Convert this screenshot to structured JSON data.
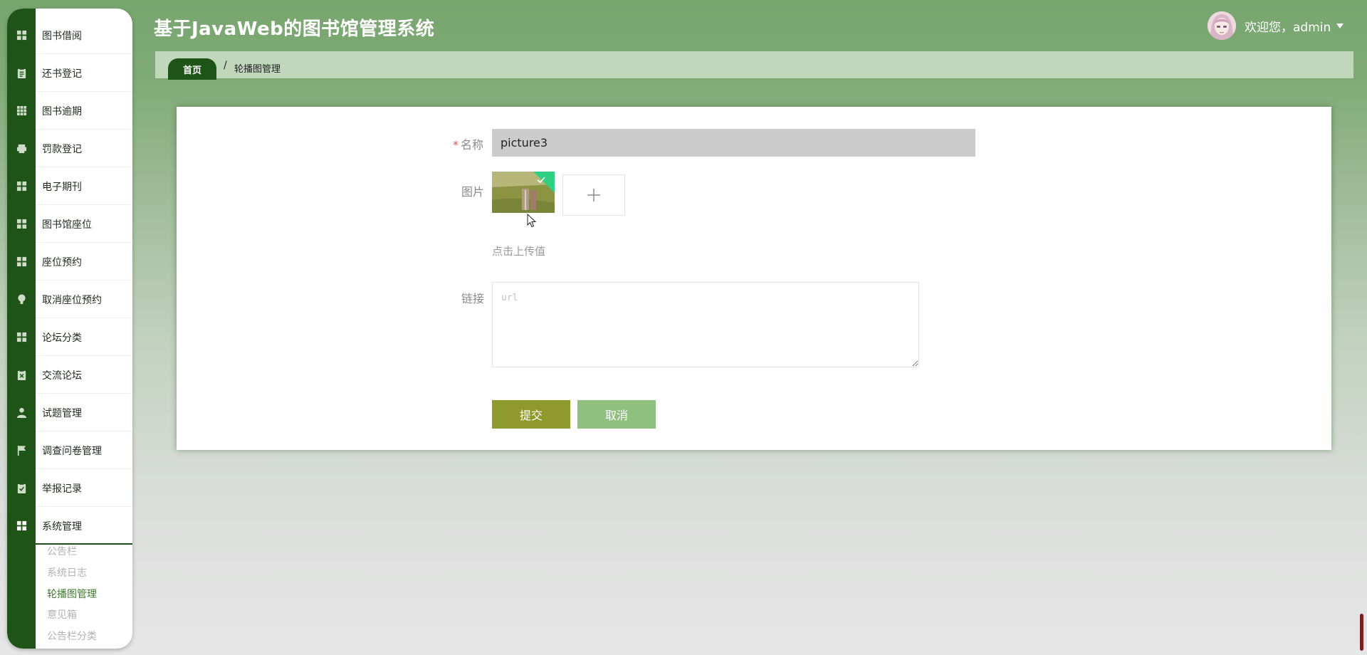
{
  "header": {
    "title": "基于JavaWeb的图书馆管理系统",
    "welcome": "欢迎您，admin"
  },
  "sidebar": {
    "items": [
      {
        "label": "图书借阅",
        "icon": "grid-icon"
      },
      {
        "label": "还书登记",
        "icon": "clipboard-icon"
      },
      {
        "label": "图书逾期",
        "icon": "apps-icon"
      },
      {
        "label": "罚款登记",
        "icon": "printer-icon"
      },
      {
        "label": "电子期刊",
        "icon": "grid-icon"
      },
      {
        "label": "图书馆座位",
        "icon": "grid-icon"
      },
      {
        "label": "座位预约",
        "icon": "grid-icon"
      },
      {
        "label": "取消座位预约",
        "icon": "bulb-icon"
      },
      {
        "label": "论坛分类",
        "icon": "grid-icon"
      },
      {
        "label": "交流论坛",
        "icon": "clipboard-x-icon"
      },
      {
        "label": "试题管理",
        "icon": "user-icon"
      },
      {
        "label": "调查问卷管理",
        "icon": "flag-icon"
      },
      {
        "label": "举报记录",
        "icon": "clipboard-check-icon"
      },
      {
        "label": "系统管理",
        "icon": "grid-icon"
      }
    ],
    "subitems": [
      {
        "label": "公告栏"
      },
      {
        "label": "系统日志"
      },
      {
        "label": "轮播图管理"
      },
      {
        "label": "意见箱"
      },
      {
        "label": "公告栏分类"
      }
    ]
  },
  "breadcrumb": {
    "home": "首页",
    "separator": "/",
    "current": "轮播图管理"
  },
  "form": {
    "required_mark": "*",
    "name_label": "名称",
    "name_value": "picture3",
    "image_label": "图片",
    "upload_hint": "点击上传值",
    "link_label": "链接",
    "link_placeholder": "url",
    "submit_label": "提交",
    "cancel_label": "取消"
  },
  "colors": {
    "sidebar_dark": "#1f5418",
    "header_green": "#78a66f",
    "submit": "#8e9a2b",
    "cancel": "#8fc07f"
  }
}
